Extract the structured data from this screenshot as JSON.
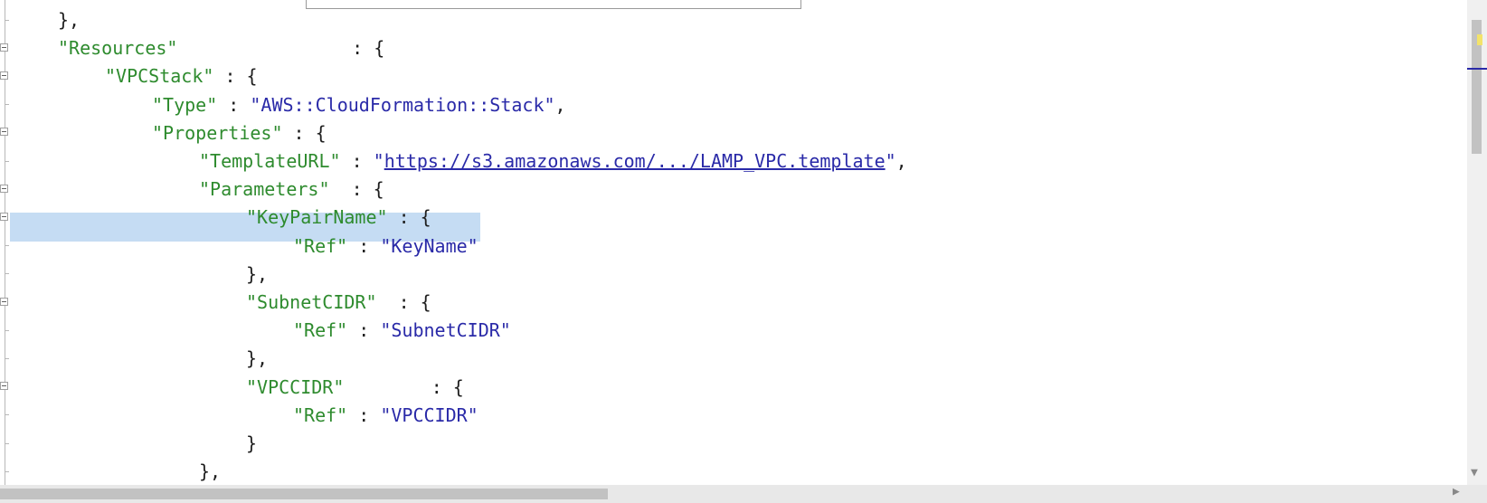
{
  "editor": {
    "lines": [
      {
        "parts": [
          {
            "c": "p",
            "t": "},"
          }
        ]
      },
      {
        "parts": [
          {
            "c": "k",
            "t": "\"Resources\""
          },
          {
            "c": "p",
            "t": "                : {"
          }
        ]
      },
      {
        "parts": [
          {
            "c": "k",
            "t": "\"VPCStack\""
          },
          {
            "c": "p",
            "t": " : {"
          }
        ]
      },
      {
        "parts": [
          {
            "c": "k",
            "t": "\"Type\""
          },
          {
            "c": "p",
            "t": " : "
          },
          {
            "c": "s",
            "t": "\"AWS::CloudFormation::Stack\""
          },
          {
            "c": "p",
            "t": ","
          }
        ]
      },
      {
        "parts": [
          {
            "c": "k",
            "t": "\"Properties\""
          },
          {
            "c": "p",
            "t": " : {"
          }
        ]
      },
      {
        "parts": [
          {
            "c": "k",
            "t": "\"TemplateURL\""
          },
          {
            "c": "p",
            "t": " : "
          },
          {
            "c": "s",
            "t": "\""
          },
          {
            "c": "u",
            "t": "https://s3.amazonaws.com/.../LAMP_VPC.template"
          },
          {
            "c": "s",
            "t": "\""
          },
          {
            "c": "p",
            "t": ","
          }
        ]
      },
      {
        "parts": [
          {
            "c": "k",
            "t": "\"Parameters\""
          },
          {
            "c": "p",
            "t": "  : {"
          }
        ]
      },
      {
        "parts": [
          {
            "c": "k",
            "t": "\"KeyPairName\""
          },
          {
            "c": "p",
            "t": " : {"
          }
        ]
      },
      {
        "parts": [
          {
            "c": "k",
            "t": "\"Ref\""
          },
          {
            "c": "p",
            "t": " : "
          },
          {
            "c": "s",
            "t": "\"KeyName\""
          }
        ]
      },
      {
        "parts": [
          {
            "c": "p",
            "t": "},"
          }
        ]
      },
      {
        "parts": [
          {
            "c": "k",
            "t": "\"SubnetCIDR\""
          },
          {
            "c": "p",
            "t": "  : {"
          }
        ]
      },
      {
        "parts": [
          {
            "c": "k",
            "t": "\"Ref\""
          },
          {
            "c": "p",
            "t": " : "
          },
          {
            "c": "s",
            "t": "\"SubnetCIDR\""
          }
        ]
      },
      {
        "parts": [
          {
            "c": "p",
            "t": "},"
          }
        ]
      },
      {
        "parts": [
          {
            "c": "k",
            "t": "\"VPCCIDR\""
          },
          {
            "c": "p",
            "t": "        : {"
          }
        ]
      },
      {
        "parts": [
          {
            "c": "k",
            "t": "\"Ref\""
          },
          {
            "c": "p",
            "t": " : "
          },
          {
            "c": "s",
            "t": "\"VPCCIDR\""
          }
        ]
      },
      {
        "parts": [
          {
            "c": "p",
            "t": "}"
          }
        ]
      },
      {
        "parts": [
          {
            "c": "p",
            "t": "},"
          }
        ]
      }
    ],
    "highlighted_line": 7
  },
  "colors": {
    "key": "#2e8b2e",
    "string": "#2a2aa8",
    "punct": "#1e1e1e",
    "selection": "#c5dcf3"
  }
}
